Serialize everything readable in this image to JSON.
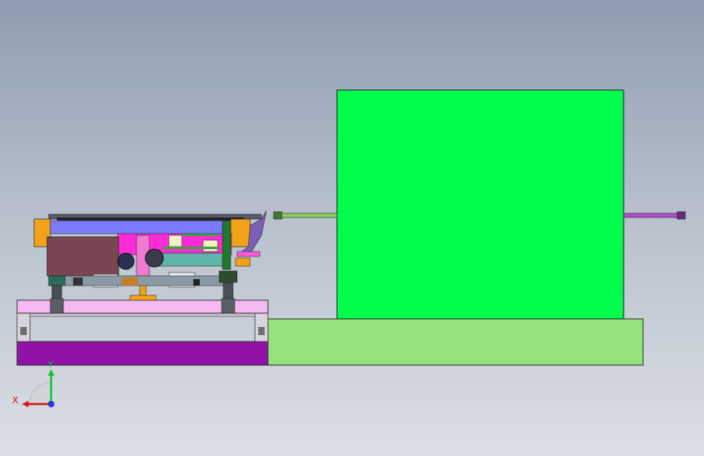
{
  "viewport": {
    "title": "",
    "axes": {
      "x_label": "X",
      "y_label": "Y"
    }
  },
  "colors": {
    "background_top": "#8e9db0",
    "background_bottom": "#dcdfe5",
    "green_block": "#00ff4c",
    "light_green_base": "#95e27a",
    "purple_base": "#9012a8",
    "pink_frame": "#f4b9f0",
    "orange_part": "#f2a219",
    "brown_panel": "#7a4654",
    "magenta_part": "#ff2bd8",
    "blue_rail": "#7b7bff",
    "teal_part": "#5fb6a8",
    "purple_rod": "#b54cd6",
    "green_rod": "#8bd25a",
    "axis_x": "#e01010",
    "axis_y": "#13c22a",
    "axis_z": "#2a3bd9"
  },
  "icons": [
    "view-triad-icon"
  ]
}
